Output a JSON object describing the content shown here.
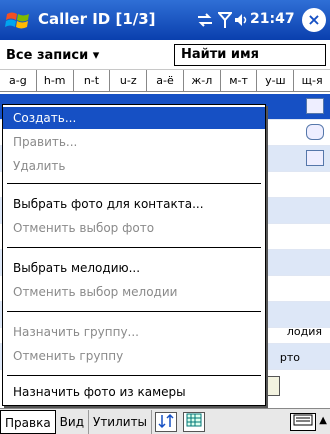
{
  "titlebar": {
    "title": "Caller ID [1/3]",
    "time": "21:47",
    "close": "×",
    "icons": [
      "windows-flag-icon",
      "connectivity-icon",
      "signal-icon",
      "volume-icon"
    ]
  },
  "filter": {
    "dropdown_label": "Все записи ▾",
    "search_value": "Найти имя"
  },
  "alphabet": [
    "a-g",
    "h-m",
    "n-t",
    "u-z",
    "а-ё",
    "ж-л",
    "м-т",
    "у-ш",
    "щ-я"
  ],
  "list": {
    "row_texts": [
      "",
      "",
      "",
      "",
      "",
      "",
      "",
      "",
      "",
      "лодия",
      "рто",
      ""
    ]
  },
  "menu": {
    "items": [
      {
        "label": "Создать...",
        "enabled": true,
        "highlighted": true
      },
      {
        "label": "Править...",
        "enabled": false
      },
      {
        "label": "Удалить",
        "enabled": false
      },
      {
        "label": "Выбрать фото для контакта...",
        "enabled": true
      },
      {
        "label": "Отменить выбор фото",
        "enabled": false
      },
      {
        "label": "Выбрать мелодию...",
        "enabled": true
      },
      {
        "label": "Отменить выбор мелодии",
        "enabled": false
      },
      {
        "label": "Назначить группу...",
        "enabled": false
      },
      {
        "label": "Отменить группу",
        "enabled": false
      },
      {
        "label": "Назначить фото из камеры",
        "enabled": true
      }
    ]
  },
  "menubar": {
    "edit": "Правка",
    "view": "Вид",
    "utilities": "Утилиты",
    "sort_icon": "sort-icon",
    "grid_icon": "grid-icon",
    "keyboard_icon": "keyboard-icon",
    "keyboard_arrow": "▲"
  },
  "colors": {
    "titlebar": "#1650c4",
    "highlight": "#1650c4",
    "disabled_text": "#8a8a8a"
  }
}
